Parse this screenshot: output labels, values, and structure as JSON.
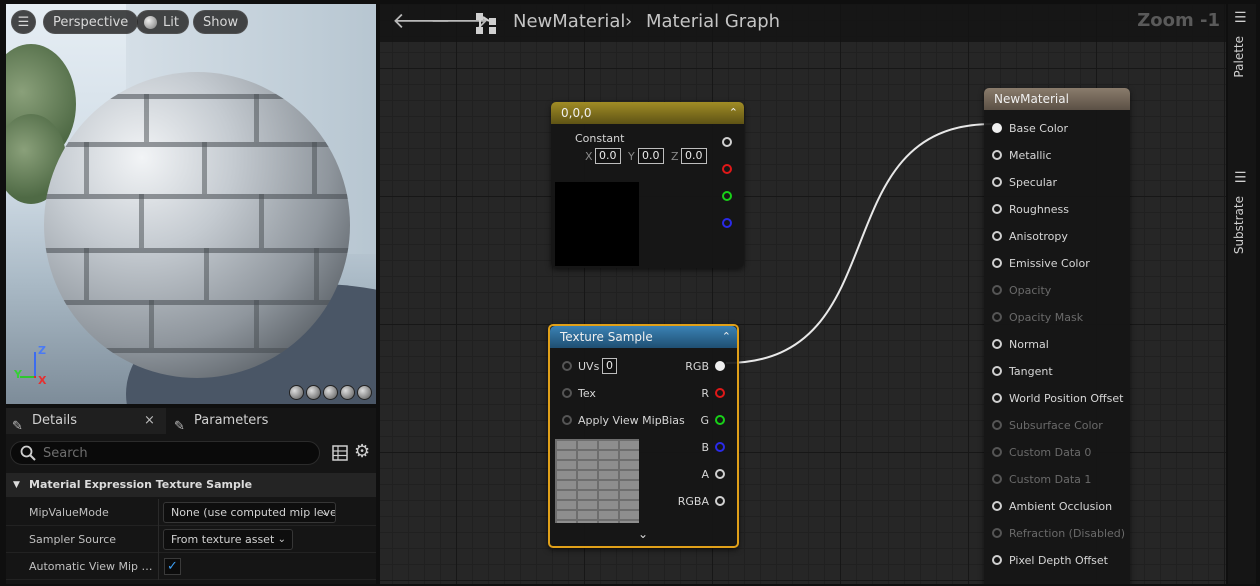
{
  "viewport": {
    "buttons": {
      "menu": "☰",
      "perspective": "Perspective",
      "lit": "Lit",
      "show": "Show"
    },
    "axes": {
      "z": "Z",
      "y": "Y",
      "x": "X"
    }
  },
  "details": {
    "tabs": [
      {
        "label": "Details",
        "close": "×"
      },
      {
        "label": "Parameters"
      }
    ],
    "search": {
      "placeholder": "Search"
    },
    "section_title": "Material Expression Texture Sample",
    "properties": [
      {
        "label": "MipValueMode",
        "value": "None (use computed mip level)"
      },
      {
        "label": "Sampler Source",
        "value": "From texture asset"
      },
      {
        "label": "Automatic View Mip Bias",
        "checked": true
      }
    ]
  },
  "graph": {
    "breadcrumb": {
      "asset": "NewMaterial",
      "separator": "›",
      "graph": "Material Graph"
    },
    "zoom": "Zoom -1",
    "constant_node": {
      "title": "0,0,0",
      "label": "Constant",
      "components": [
        {
          "axis": "X",
          "value": "0.0"
        },
        {
          "axis": "Y",
          "value": "0.0"
        },
        {
          "axis": "Z",
          "value": "0.0"
        }
      ],
      "preview_color": "#000000"
    },
    "texture_node": {
      "title": "Texture Sample",
      "inputs": [
        {
          "label": "UVs",
          "value": "0"
        },
        {
          "label": "Tex"
        },
        {
          "label": "Apply View MipBias"
        }
      ],
      "outputs": [
        "RGB",
        "R",
        "G",
        "B",
        "A",
        "RGBA"
      ]
    },
    "material_node": {
      "title": "NewMaterial",
      "inputs": [
        {
          "label": "Base Color",
          "enabled": true,
          "connected": true
        },
        {
          "label": "Metallic",
          "enabled": true
        },
        {
          "label": "Specular",
          "enabled": true
        },
        {
          "label": "Roughness",
          "enabled": true
        },
        {
          "label": "Anisotropy",
          "enabled": true
        },
        {
          "label": "Emissive Color",
          "enabled": true
        },
        {
          "label": "Opacity",
          "enabled": false
        },
        {
          "label": "Opacity Mask",
          "enabled": false
        },
        {
          "label": "Normal",
          "enabled": true
        },
        {
          "label": "Tangent",
          "enabled": true
        },
        {
          "label": "World Position Offset",
          "enabled": true
        },
        {
          "label": "Subsurface Color",
          "enabled": false
        },
        {
          "label": "Custom Data 0",
          "enabled": false
        },
        {
          "label": "Custom Data 1",
          "enabled": false
        },
        {
          "label": "Ambient Occlusion",
          "enabled": true
        },
        {
          "label": "Refraction (Disabled)",
          "enabled": false
        },
        {
          "label": "Pixel Depth Offset",
          "enabled": true
        }
      ]
    }
  },
  "side_panel": {
    "palette": "Palette",
    "substrate": "Substrate"
  },
  "colors": {
    "constant_header": "#8a7a20",
    "texture_header": "#2f6e9a",
    "material_header": "#7a6d5f",
    "selection_outline": "#e0a019",
    "pin_red": "#e01818",
    "pin_green": "#18d018",
    "pin_blue": "#2a2ae8"
  }
}
